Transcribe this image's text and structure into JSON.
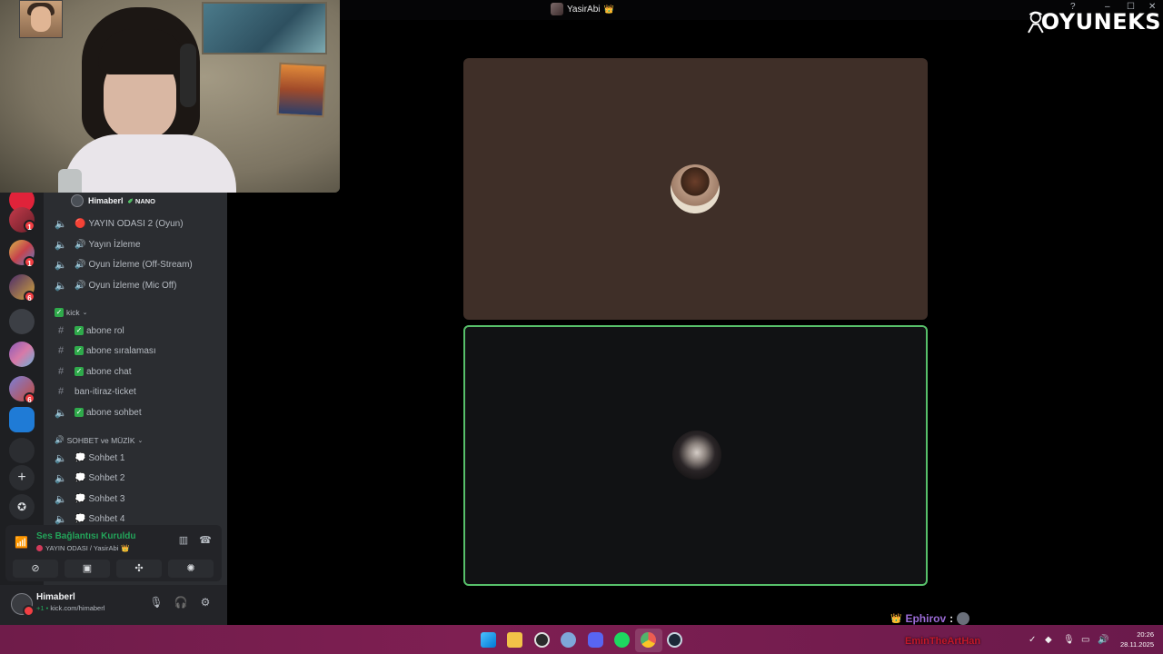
{
  "titlebar": {
    "title": "YasirAbi",
    "crown": "👑"
  },
  "logo": {
    "text": "OYUNEKS"
  },
  "window_controls": {
    "help": "?",
    "minimize": "–",
    "maximize": "☐",
    "close": "✕"
  },
  "voice_member": {
    "name": "Himaberl",
    "tag": "NANO"
  },
  "channels": [
    {
      "kind": "voice",
      "emoji": "🔴",
      "label": "YAYIN ODASI 2 (Oyun)"
    },
    {
      "kind": "voice",
      "emoji": "🔊",
      "label": "Yayın İzleme"
    },
    {
      "kind": "voice",
      "emoji": "🔊",
      "label": "Oyun İzleme (Off-Stream)"
    },
    {
      "kind": "voice",
      "emoji": "🔊",
      "label": "Oyun İzleme (Mic Off)"
    }
  ],
  "category_kick": {
    "label": "kick"
  },
  "text_channels": [
    {
      "label": "abone  rol"
    },
    {
      "label": "abone  sıralaması"
    },
    {
      "label": "abone  chat"
    },
    {
      "label": "ban-itiraz-ticket"
    },
    {
      "label": "abone sohbet"
    }
  ],
  "category_sohbet": {
    "label": "SOHBET ve MÜZİK"
  },
  "sohbet_channels": [
    {
      "label": "Sohbet 1"
    },
    {
      "label": "Sohbet 2"
    },
    {
      "label": "Sohbet 3"
    },
    {
      "label": "Sohbet 4"
    }
  ],
  "server_badges": [
    "1",
    "1",
    "6",
    "6"
  ],
  "voice_panel": {
    "status": "Ses Bağlantısı Kuruldu",
    "room": "YAYIN ODASI / YasirAbi"
  },
  "user": {
    "name": "Himaberl",
    "sub": "kick.com/himaberl",
    "sub_prefix": "+1 •"
  },
  "chat_overlay": {
    "name": "Ephirov",
    "separator": ":",
    "red_text": "EminTheArtHan"
  },
  "clock": {
    "time": "20:26",
    "date": "28.11.2025"
  },
  "colors": {
    "speaking_border": "#57c06a",
    "connected_green": "#23a55a",
    "taskbar": "#7e1f52"
  }
}
